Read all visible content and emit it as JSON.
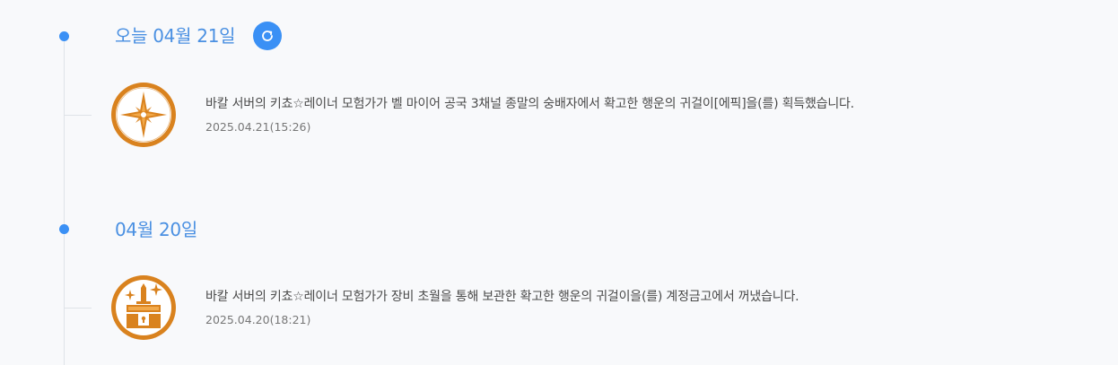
{
  "timeline": {
    "days": [
      {
        "title": "오늘 04월 21일",
        "has_refresh": true,
        "events": [
          {
            "icon": "compass-star-icon",
            "message": "바칼 서버의 키쵸☆레이너 모험가가 벨 마이어 공국 3채널 종말의 숭배자에서 확고한 행운의 귀걸이[에픽]을(를) 획득했습니다.",
            "datetime": "2025.04.21(15:26)"
          }
        ]
      },
      {
        "title": "04월 20일",
        "has_refresh": false,
        "events": [
          {
            "icon": "treasure-chest-icon",
            "message": "바칼 서버의 키쵸☆레이너 모험가가 장비 초월을 통해 보관한 확고한 행운의 귀걸이을(를) 계정금고에서 꺼냈습니다.",
            "datetime": "2025.04.20(18:21)"
          }
        ]
      }
    ]
  },
  "colors": {
    "accent": "#3a90f5",
    "title": "#4a90e2",
    "icon_orange": "#d9821e",
    "background": "#f8f9fb"
  }
}
